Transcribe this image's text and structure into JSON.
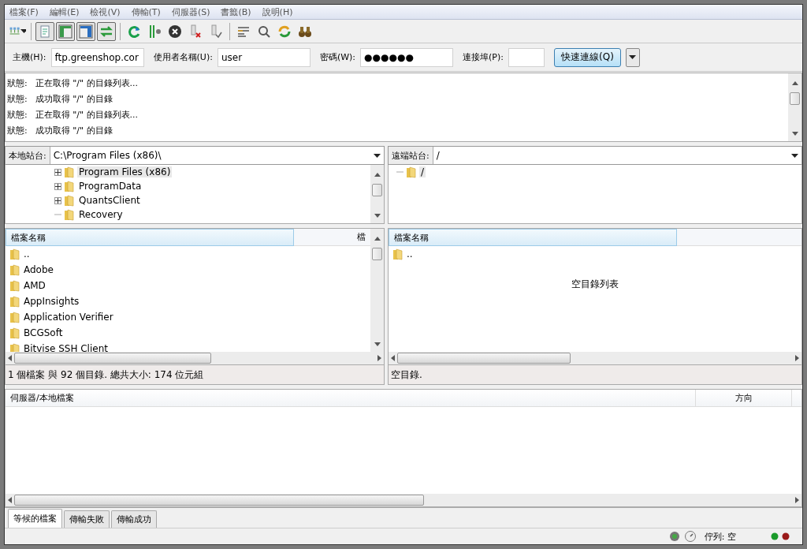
{
  "menu": [
    "檔案(F)",
    "編輯(E)",
    "檢視(V)",
    "傳輸(T)",
    "伺服器(S)",
    "書籤(B)",
    "說明(H)"
  ],
  "toolbar": [
    {
      "kind": "sitemanager"
    },
    {
      "kind": "sep"
    },
    {
      "kind": "log",
      "on": true
    },
    {
      "kind": "localtree",
      "on": true
    },
    {
      "kind": "remotetree",
      "on": true
    },
    {
      "kind": "queue",
      "on": true
    },
    {
      "kind": "sep"
    },
    {
      "kind": "refresh"
    },
    {
      "kind": "filter"
    },
    {
      "kind": "cancel"
    },
    {
      "kind": "disconnect"
    },
    {
      "kind": "reconnect"
    },
    {
      "kind": "sep"
    },
    {
      "kind": "compare"
    },
    {
      "kind": "sync"
    },
    {
      "kind": "syncbrowse"
    },
    {
      "kind": "find"
    }
  ],
  "quickconnect": {
    "fields": [
      {
        "label": "主機(H):",
        "value": "ftp.greenshop.cor"
      },
      {
        "label": "使用者名稱(U):",
        "value": "user"
      },
      {
        "label": "密碼(W):",
        "value": "●●●●●●"
      },
      {
        "label": "連接埠(P):"
      }
    ],
    "button": "快速連線(Q)"
  },
  "log": [
    {
      "label": "狀態:",
      "message": "正在取得 \"/\" 的目錄列表..."
    },
    {
      "label": "狀態:",
      "message": "成功取得 \"/\" 的目錄"
    },
    {
      "label": "狀態:",
      "message": "正在取得 \"/\" 的目錄列表..."
    },
    {
      "label": "狀態:",
      "message": "成功取得 \"/\" 的目錄"
    }
  ],
  "local": {
    "site_label": "本地站台:",
    "path": "C:\\Program Files (x86)\\",
    "tree": [
      {
        "label": "Program Files (x86)",
        "selected": true,
        "expandable": true
      },
      {
        "label": "ProgramData",
        "selected": false,
        "expandable": true
      },
      {
        "label": "QuantsClient",
        "selected": false,
        "expandable": true
      },
      {
        "label": "Recovery",
        "selected": false,
        "expandable": false
      }
    ],
    "columns": [
      "檔案名稱",
      "檔"
    ],
    "files": [
      "..",
      "Adobe",
      "AMD",
      "AppInsights",
      "Application Verifier",
      "BCGSoft",
      "Bitvise SSH Client"
    ],
    "status": "1 個檔案 與 92 個目錄. 總共大小: 174 位元組"
  },
  "remote": {
    "site_label": "遠端站台:",
    "path": "/",
    "tree": [
      {
        "label": "/",
        "selected": true,
        "expandable": false
      }
    ],
    "columns": [
      "檔案名稱"
    ],
    "files": [
      ".."
    ],
    "empty_message": "空目錄列表",
    "status": "空目錄."
  },
  "queue": {
    "columns": [
      "伺服器/本地檔案",
      "方向"
    ]
  },
  "tabs": [
    {
      "label": "等候的檔案",
      "selected": true
    },
    {
      "label": "傳輸失敗",
      "selected": false
    },
    {
      "label": "傳輸成功",
      "selected": false
    }
  ],
  "status_bar": {
    "queue": "佇列: 空"
  }
}
